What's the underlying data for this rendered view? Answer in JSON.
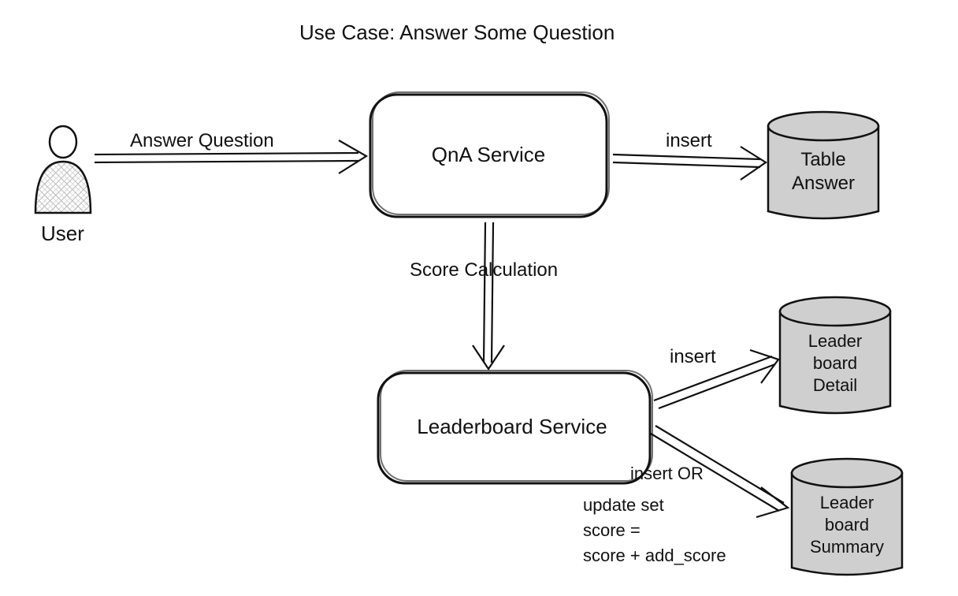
{
  "title": "Use Case: Answer Some Question",
  "actor": {
    "label": "User"
  },
  "nodes": {
    "qna": {
      "label": "QnA Service"
    },
    "leaderboard": {
      "label": "Leaderboard Service"
    },
    "dbAnswer": {
      "line1": "Table",
      "line2": "Answer"
    },
    "dbDetail": {
      "line1": "Leader",
      "line2": "board",
      "line3": "Detail"
    },
    "dbSummary": {
      "line1": "Leader",
      "line2": "board",
      "line3": "Summary"
    }
  },
  "edges": {
    "userToQna": {
      "label": "Answer Question"
    },
    "qnaToAnswer": {
      "label": "insert"
    },
    "qnaToLeader": {
      "label": "Score Calculation"
    },
    "leaderToDetail": {
      "label": "insert"
    },
    "leaderToSummary": {
      "line1": "insert OR",
      "line2": "update set",
      "line3": "score =",
      "line4": "score + add_score"
    }
  }
}
